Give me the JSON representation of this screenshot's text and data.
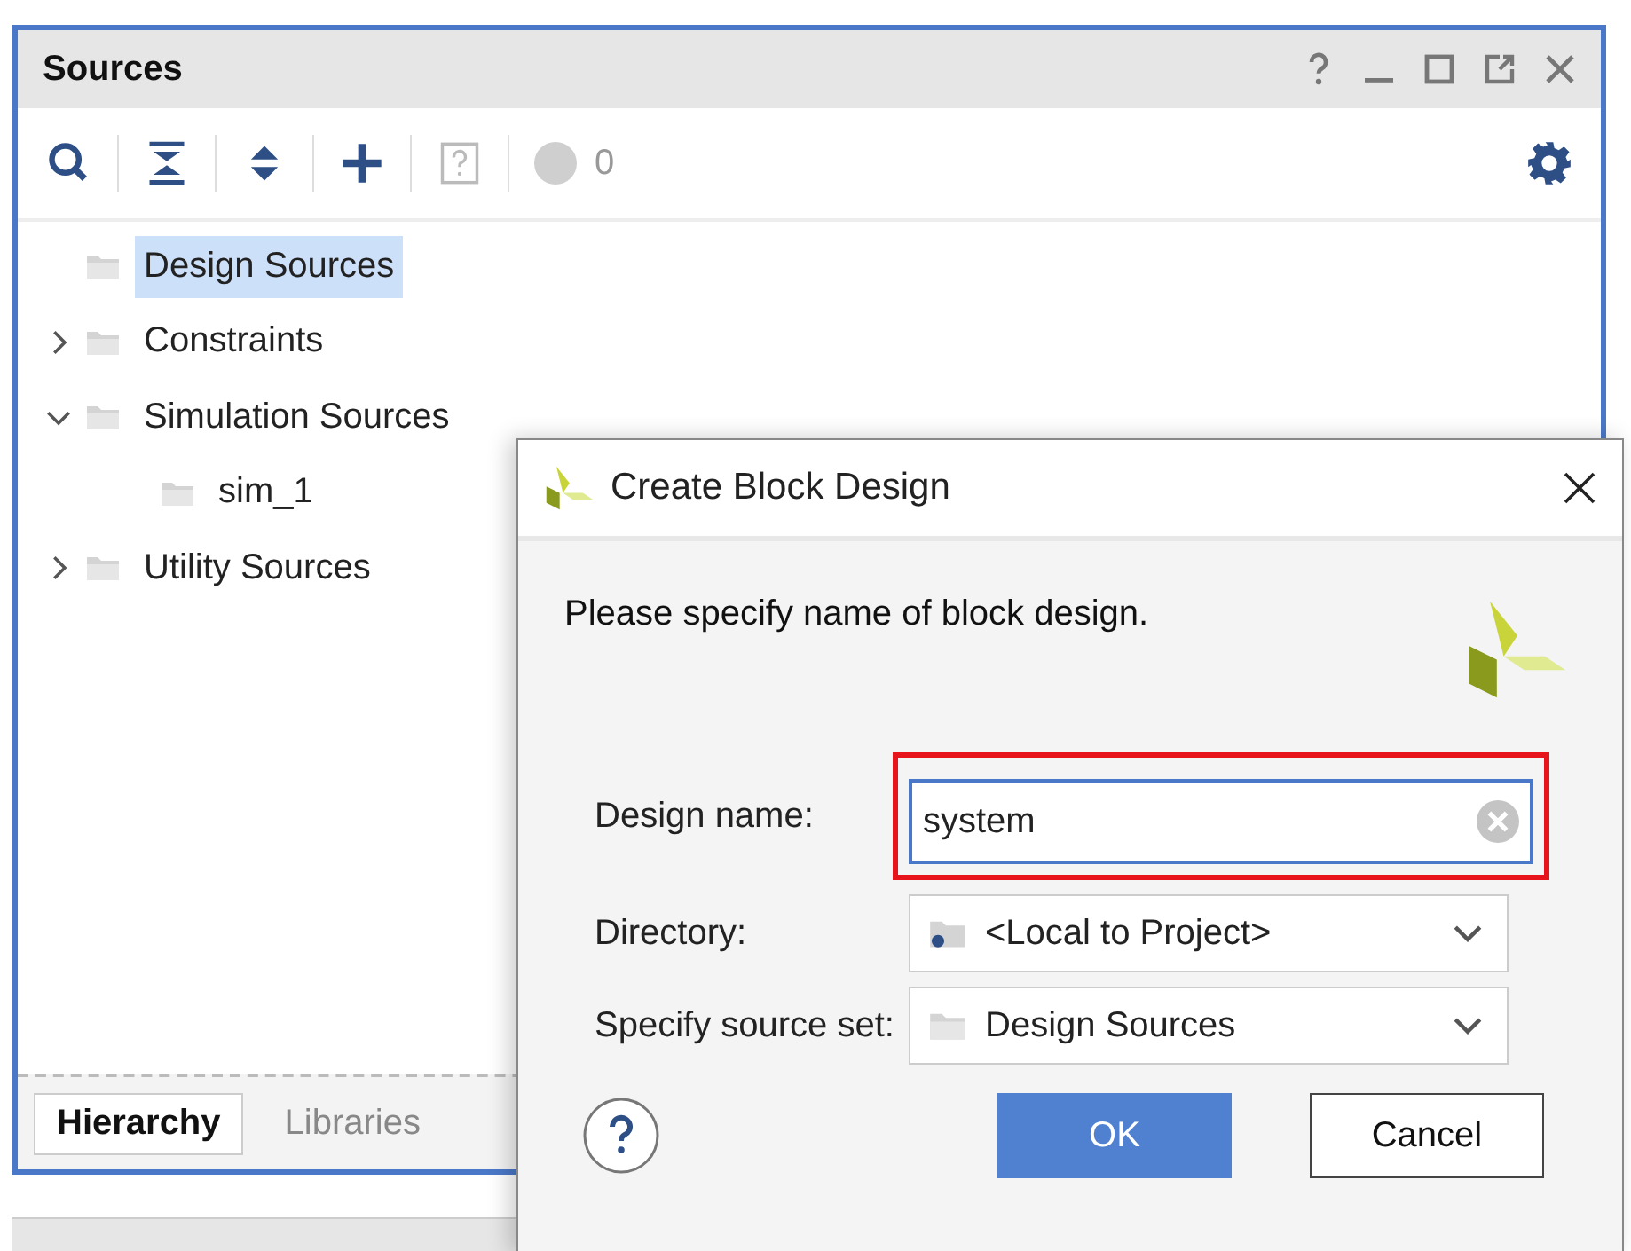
{
  "panel": {
    "title": "Sources",
    "toolbar": {
      "status_count": "0"
    },
    "tree": [
      {
        "label": "Design Sources",
        "selected": true
      },
      {
        "label": "Constraints",
        "selected": false,
        "expanded": false
      },
      {
        "label": "Simulation Sources",
        "selected": false,
        "expanded": true,
        "children": [
          {
            "label": "sim_1",
            "selected": false
          }
        ]
      },
      {
        "label": "Utility Sources",
        "selected": false,
        "expanded": false
      }
    ],
    "tabs": [
      {
        "label": "Hierarchy",
        "selected": true
      },
      {
        "label": "Libraries",
        "selected": false
      }
    ]
  },
  "dialog": {
    "title": "Create Block Design",
    "prompt": "Please specify name of block design.",
    "fields": [
      {
        "kind": "text",
        "label": "Design name:",
        "value": "system",
        "highlighted": true
      },
      {
        "kind": "dropdown",
        "label": "Directory:",
        "value": "<Local to Project>"
      },
      {
        "kind": "dropdown",
        "label": "Specify source set:",
        "value": "Design Sources"
      }
    ],
    "buttons": [
      {
        "label": "OK",
        "primary": true
      },
      {
        "label": "Cancel",
        "primary": false
      }
    ]
  }
}
